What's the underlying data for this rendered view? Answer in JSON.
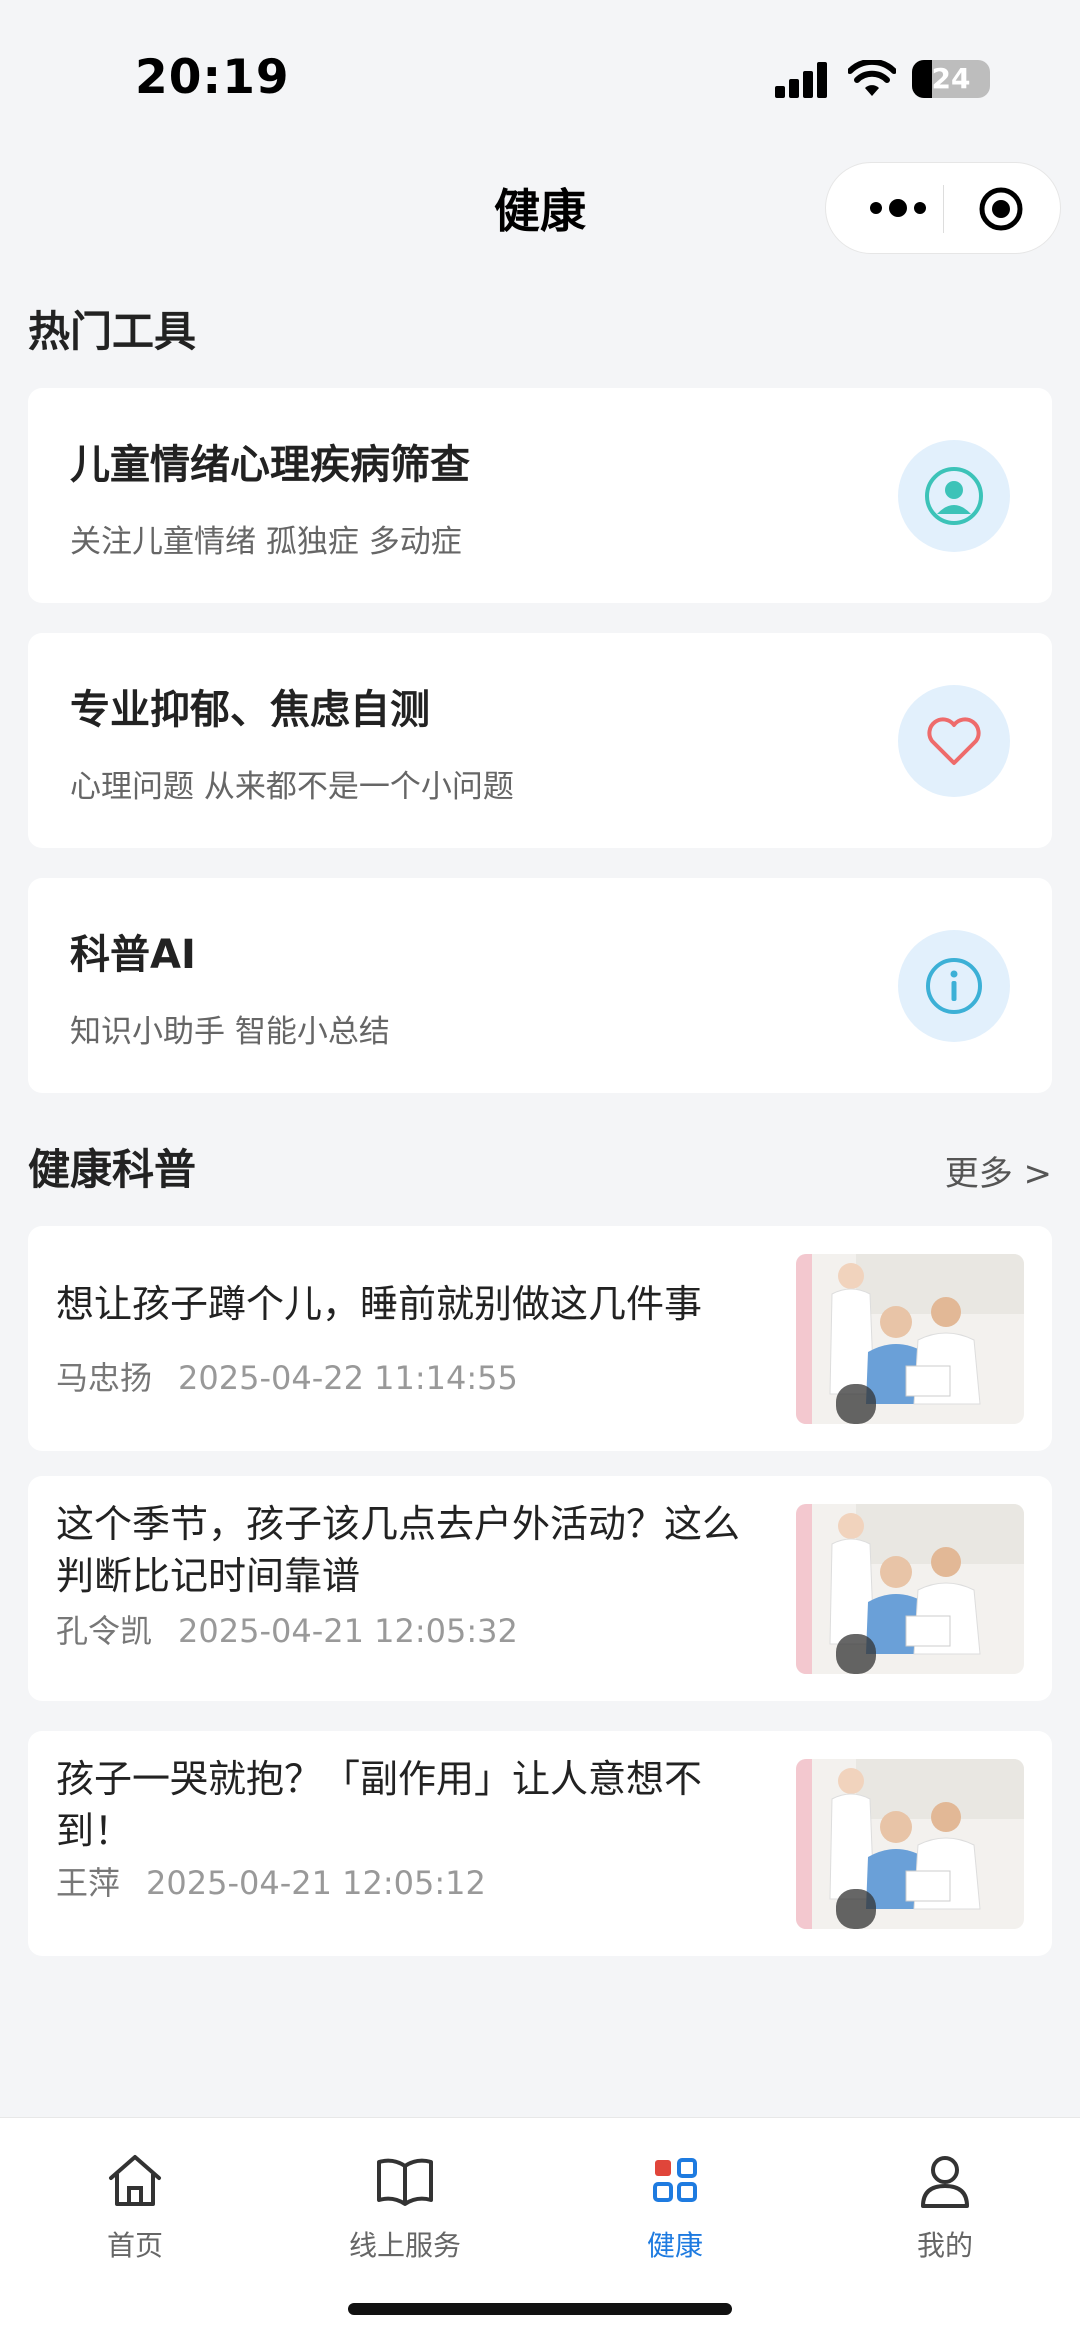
{
  "status_bar": {
    "time": "20:19",
    "battery": "24"
  },
  "nav": {
    "title": "健康"
  },
  "hot_tools": {
    "title": "热门工具",
    "items": [
      {
        "title": "儿童情绪心理疾病筛查",
        "subtitle": "关注儿童情绪 孤独症 多动症",
        "icon": "person-icon",
        "icon_color": "#3cc3b8"
      },
      {
        "title": "专业抑郁、焦虑自测",
        "subtitle": "心理问题 从来都不是一个小问题",
        "icon": "heart-icon",
        "icon_color": "#ee6b6b"
      },
      {
        "title": "科普AI",
        "subtitle": "知识小助手 智能小总结",
        "icon": "info-icon",
        "icon_color": "#3cb0d6"
      }
    ]
  },
  "health_science": {
    "title": "健康科普",
    "more_label": "更多 >",
    "articles": [
      {
        "title": "想让孩子蹲个儿，睡前就别做这几件事",
        "author": "马忠扬",
        "time": "2025-04-22 11:14:55"
      },
      {
        "title": "这个季节，孩子该几点去户外活动？这么判断比记时间靠谱",
        "author": "孔令凯",
        "time": "2025-04-21 12:05:32"
      },
      {
        "title": "孩子一哭就抱？「副作用」让人意想不到！",
        "author": "王萍",
        "time": "2025-04-21 12:05:12"
      }
    ]
  },
  "tab_bar": {
    "items": [
      {
        "label": "首页",
        "icon": "home-icon"
      },
      {
        "label": "线上服务",
        "icon": "book-icon"
      },
      {
        "label": "健康",
        "icon": "grid-icon",
        "active": true
      },
      {
        "label": "我的",
        "icon": "user-icon"
      }
    ],
    "active_color": "#1e7be0"
  }
}
